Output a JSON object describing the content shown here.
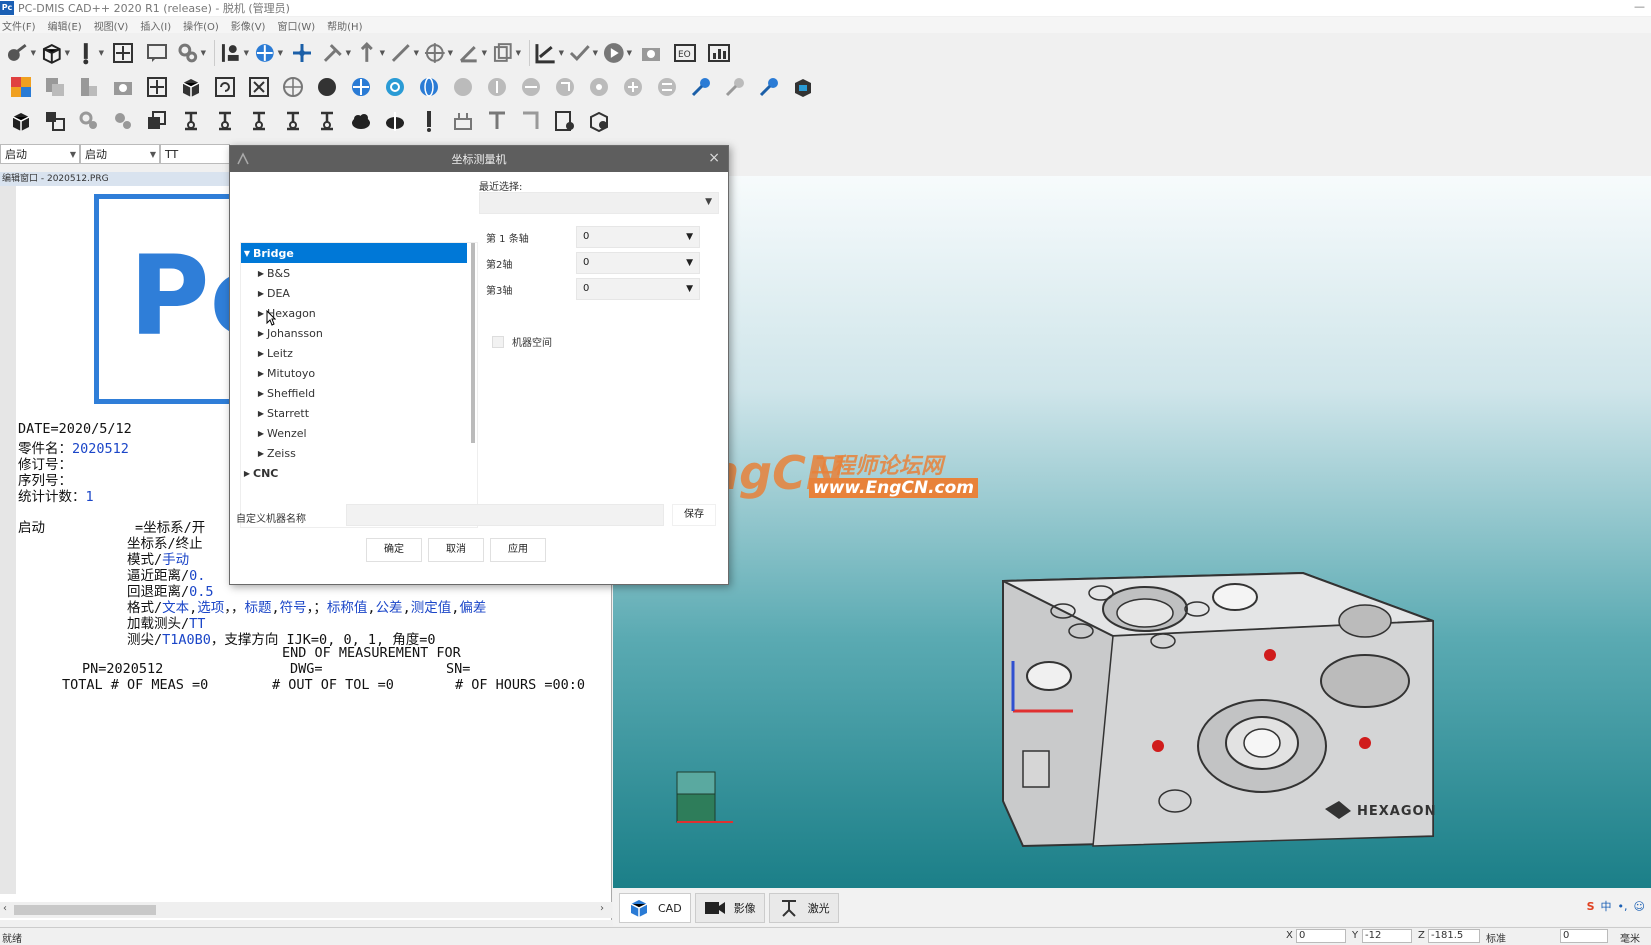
{
  "window": {
    "title": "PC-DMIS CAD++ 2020 R1 (release) - 脱机 (管理员)"
  },
  "menu": [
    "文件(F)",
    "编辑(E)",
    "视图(V)",
    "插入(I)",
    "操作(O)",
    "影像(V)",
    "窗口(W)",
    "帮助(H)"
  ],
  "combos": {
    "mode1": "启动",
    "mode2": "启动",
    "probe": "TT"
  },
  "edit_window": {
    "title": "编辑窗口 - 2020512.PRG",
    "logo_text": "Pc",
    "header_lines": [
      "DATE=2020/5/12",
      "零件名：",
      "修订号：",
      "序列号：",
      "统计计数："
    ],
    "part_name": "2020512",
    "stat_count": "1",
    "label_start": "启动",
    "cmd": {
      "l1": "=坐标系/开",
      "l2": "坐标系/终止",
      "l3_a": "模式/",
      "l3_b": "手动",
      "l4_a": "逼近距离/",
      "l4_b": "0.",
      "l5_a": "回退距离/",
      "l5_b": "0.5",
      "l6_a": "格式/",
      "l6_b": "文本",
      "l6_c": ",",
      "l6_d": "选项",
      "l6_e": "，，",
      "l6_f": "标题",
      "l6_g": ",",
      "l6_h": "符号",
      "l6_i": "，；",
      "l6_j": "标称值",
      "l6_k": ",",
      "l6_l": "公差",
      "l6_m": ",",
      "l6_n": "测定值",
      "l6_o": ",",
      "l6_p": "偏差",
      "l7_a": "加载测头/",
      "l7_b": "TT",
      "l8_a": "测尖/",
      "l8_b": "T1A0B0",
      "l8_c": "，支撑方向 IJK=0, 0, 1, 角度=0"
    },
    "report": {
      "r1": "END OF MEASUREMENT FOR",
      "r2_a": "PN=2020512",
      "r2_b": "DWG=",
      "r2_c": "SN=",
      "r3_a": "TOTAL # OF MEAS =0",
      "r3_b": "# OUT OF TOL =0",
      "r3_c": "# OF HOURS =00:0"
    }
  },
  "dialog": {
    "title": "坐标测量机",
    "recent_label": "最近选择:",
    "recent_value": "",
    "tree": {
      "root": "Bridge",
      "children": [
        "B&S",
        "DEA",
        "Hexagon",
        "Johansson",
        "Leitz",
        "Mitutoyo",
        "Sheffield",
        "Starrett",
        "Wenzel",
        "Zeiss"
      ],
      "next_root": "CNC"
    },
    "axes": [
      {
        "label": "第 1 条轴",
        "value": "0"
      },
      {
        "label": "第2轴",
        "value": "0"
      },
      {
        "label": "第3轴",
        "value": "0"
      }
    ],
    "checkbox_label": "机器空间",
    "custom_label": "自定义机器名称",
    "custom_value": "",
    "save": "保存",
    "ok": "确定",
    "cancel": "取消",
    "apply": "应用"
  },
  "watermark": {
    "eng": "EngCN",
    "cn": "工程师论坛网",
    "url": "www.EngCN.com"
  },
  "model": {
    "brand": "HEXAGON"
  },
  "tabs": [
    "CAD",
    "影像",
    "激光"
  ],
  "statusbar": {
    "left": "就绪",
    "x_label": "X",
    "x_value": "0",
    "y_label": "Y",
    "y_value": "-12",
    "z_label": "Z",
    "z_value": "-181.5",
    "mode_label": "标准",
    "field": "0",
    "unit": "毫米"
  },
  "colors": {
    "accent": "#0078d7",
    "code_blue": "#1b46c8",
    "watermark": "#e8823a",
    "viewport_bottom": "#1b7f88"
  }
}
